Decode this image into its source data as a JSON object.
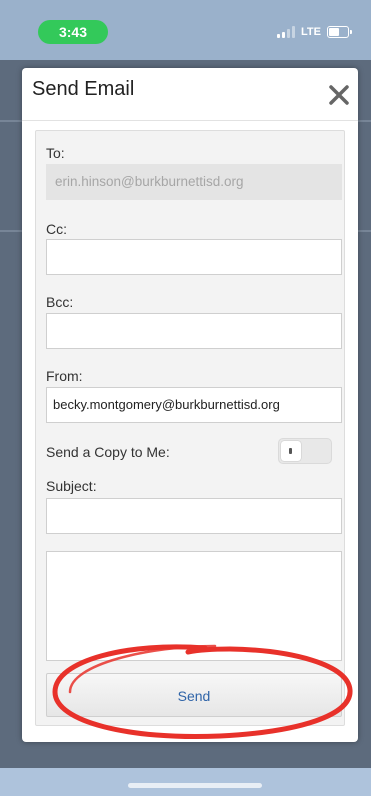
{
  "status_bar": {
    "time": "3:43",
    "network": "LTE",
    "signal_bars_active": 2,
    "signal_bars_total": 4,
    "battery_level": 0.6
  },
  "modal": {
    "title": "Send Email",
    "close_icon": "close-icon"
  },
  "form": {
    "to_label": "To:",
    "to_value": "erin.hinson@burkburnettisd.org",
    "cc_label": "Cc:",
    "cc_value": "",
    "bcc_label": "Bcc:",
    "bcc_value": "",
    "from_label": "From:",
    "from_value": "becky.montgomery@burkburnettisd.org",
    "copy_label": "Send a Copy to Me:",
    "copy_on": false,
    "subject_label": "Subject:",
    "subject_value": "",
    "body_value": "",
    "send_label": "Send"
  },
  "colors": {
    "accent": "#2f64a8",
    "status_pill": "#33c95a",
    "annotation": "#e8312a"
  }
}
